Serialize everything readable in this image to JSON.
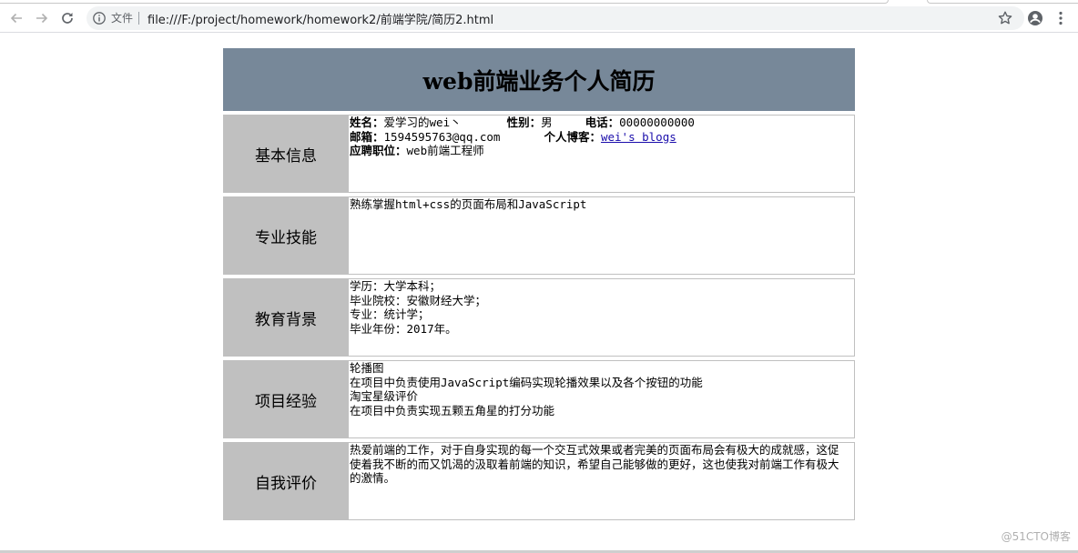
{
  "browser": {
    "security_label": "文件",
    "url": "file:///F:/project/homework/homework2/前端学院/简历2.html"
  },
  "resume": {
    "title": "web前端业务个人简历",
    "basic": {
      "label": "基本信息",
      "name_key": "姓名：",
      "name_value": "爱学习的wei丶",
      "gender_key": "性别：",
      "gender_value": "男",
      "phone_key": "电话：",
      "phone_value": "00000000000",
      "email_key": "邮箱：",
      "email_value": "1594595763@qq.com",
      "blog_key": "个人博客：",
      "blog_link": "wei's blogs",
      "position_key": "应聘职位：",
      "position_value": "web前端工程师"
    },
    "skills": {
      "label": "专业技能",
      "lines": [
        "熟练掌握html+css的页面布局和JavaScript"
      ]
    },
    "education": {
      "label": "教育背景",
      "lines": [
        "学历：大学本科；",
        "毕业院校：安徽财经大学；",
        "专业：统计学；",
        "毕业年份：2017年。"
      ]
    },
    "projects": {
      "label": "项目经验",
      "lines": [
        "轮播图",
        "在项目中负责使用JavaScript编码实现轮播效果以及各个按钮的功能",
        "淘宝星级评价",
        "在项目中负责实现五颗五角星的打分功能"
      ]
    },
    "self_eval": {
      "label": "自我评价",
      "text": "热爱前端的工作，对于自身实现的每一个交互式效果或者完美的页面布局会有极大的成就感，这促使着我不断的而又饥渴的汲取着前端的知识，希望自己能够做的更好，这也使我对前端工作有极大的激情。"
    }
  },
  "watermark": "@51CTO博客"
}
